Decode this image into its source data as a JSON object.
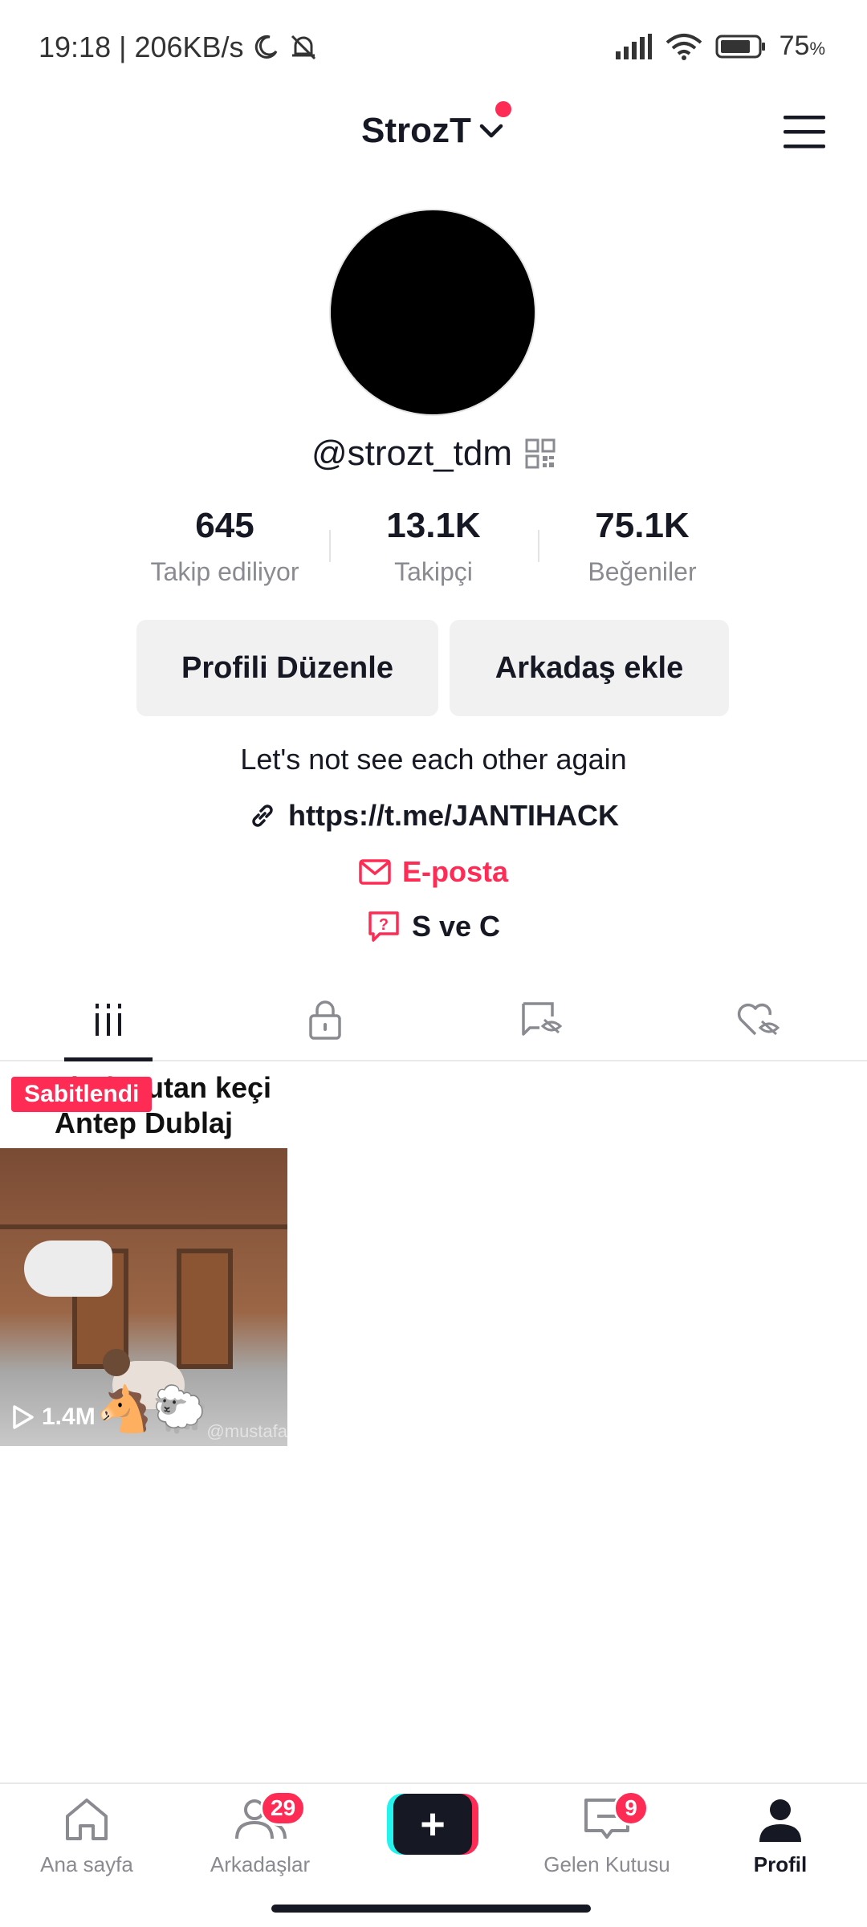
{
  "status_bar": {
    "time_speed": "19:18 | 206KB/s",
    "battery": "75",
    "battery_unit": "%"
  },
  "header": {
    "account_name": "StrozT",
    "has_notification_dot": true
  },
  "profile": {
    "handle": "@strozt_tdm",
    "stats": [
      {
        "value": "645",
        "label": "Takip ediliyor"
      },
      {
        "value": "13.1K",
        "label": "Takipçi"
      },
      {
        "value": "75.1K",
        "label": "Beğeniler"
      }
    ],
    "edit_button": "Profili Düzenle",
    "add_friend_button": "Arkadaş ekle",
    "bio": "Let's not see each other again",
    "link": "https://t.me/JANTIHACK",
    "email_label": "E-posta",
    "qa_label": "S ve C"
  },
  "tabs": [
    {
      "icon": "videos-grid-icon",
      "active": true
    },
    {
      "icon": "lock-icon",
      "active": false
    },
    {
      "icon": "hidden-repost-icon",
      "active": false
    },
    {
      "icon": "hidden-likes-icon",
      "active": false
    }
  ],
  "videos": [
    {
      "caption_line1": "Ata kafa tutan keçi",
      "caption_line2": "Antep Dublaj",
      "pinned_label": "Sabitlendi",
      "views": "1.4M",
      "emoji": "🐴🐑",
      "watermark": "@mustafa"
    }
  ],
  "bottom_nav": {
    "items": [
      {
        "label": "Ana sayfa",
        "icon": "home-icon",
        "active": false
      },
      {
        "label": "Arkadaşlar",
        "icon": "friends-icon",
        "badge": "29",
        "active": false
      },
      {
        "label": "",
        "icon": "create-icon",
        "active": false
      },
      {
        "label": "Gelen Kutusu",
        "icon": "inbox-icon",
        "badge": "9",
        "active": false
      },
      {
        "label": "Profil",
        "icon": "profile-icon",
        "active": true
      }
    ]
  },
  "colors": {
    "accent": "#fe2c55",
    "text": "#161823",
    "muted": "#8a8b91",
    "button_bg": "#f1f1f2"
  }
}
